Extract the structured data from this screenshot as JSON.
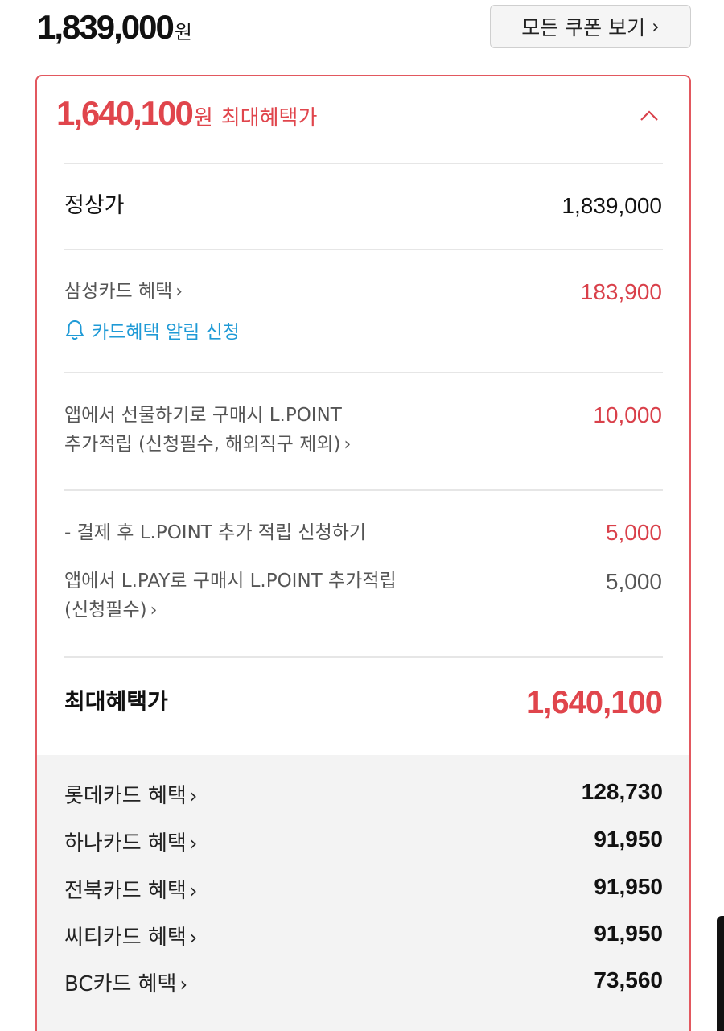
{
  "header": {
    "original_price": "1,839,000",
    "currency_unit": "원",
    "coupon_button_label": "모든 쿠폰 보기",
    "coupon_chevron": "›"
  },
  "benefit": {
    "best_price": "1,640,100",
    "best_price_unit": "원",
    "best_price_label": "최대혜택가",
    "collapse_icon": "chevron-up-icon",
    "accent_color": "#e0454c",
    "rows": {
      "regular": {
        "label": "정상가",
        "value": "1,839,000"
      },
      "samsung": {
        "label": "삼성카드 혜택",
        "chevron": "›",
        "value": "183,900"
      },
      "alarm": {
        "label": "카드혜택 알림 신청",
        "icon": "bell-icon",
        "color": "#1f9ad6"
      },
      "gift": {
        "line1": "앱에서 선물하기로 구매시 L.POINT",
        "line2": "추가적립 (신청필수, 해외직구 제외)",
        "chevron": "›",
        "value": "10,000"
      },
      "lpoint": {
        "label": "- 결제 후 L.POINT 추가 적립 신청하기",
        "value": "5,000"
      },
      "lpay": {
        "line1": "앱에서 L.PAY로 구매시 L.POINT 추가적립",
        "line2": "(신청필수)",
        "chevron": "›",
        "value": "5,000"
      }
    },
    "max": {
      "label": "최대혜택가",
      "value": "1,640,100"
    },
    "other_cards": [
      {
        "name": "롯데카드 혜택",
        "value": "128,730"
      },
      {
        "name": "하나카드 혜택",
        "value": "91,950"
      },
      {
        "name": "전북카드 혜택",
        "value": "91,950"
      },
      {
        "name": "씨티카드 혜택",
        "value": "91,950"
      },
      {
        "name": "BC카드 혜택",
        "value": "73,560"
      }
    ],
    "card_chevron": "›"
  }
}
